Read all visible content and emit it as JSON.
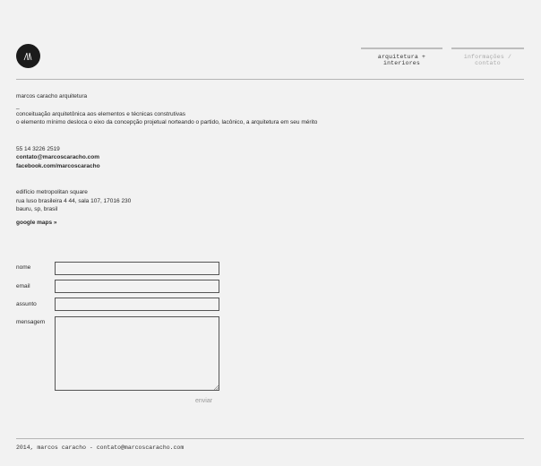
{
  "header": {
    "logo_icon": "monogram-logo-icon",
    "nav": {
      "arquitetura": "arquitetura + interiores",
      "informacoes": "informações / contato"
    }
  },
  "about": {
    "name": "marcos caracho arquitetura",
    "dash": "_",
    "line1": "conceituação arquitetônica aos elementos e técnicas construtivas",
    "line2": "o elemento mínimo desloca o eixo da concepção projetual norteando o partido, lacônico, a arquitetura em seu mérito"
  },
  "contact": {
    "phone": "55 14 3226 2519",
    "email": "contato@marcoscaracho.com",
    "facebook": "facebook.com/marcoscaracho"
  },
  "address": {
    "building": "edifício metropolitan square",
    "street": "rua luso brasileira 4 44, sala 107, 17016 230",
    "city": "bauru, sp, brasil",
    "maps_link": "google maps »"
  },
  "form": {
    "nome_label": "nome",
    "email_label": "email",
    "assunto_label": "assunto",
    "mensagem_label": "mensagem",
    "nome_value": "",
    "email_value": "",
    "assunto_value": "",
    "mensagem_value": "",
    "submit_label": "enviar"
  },
  "footer": {
    "text": "2014, marcos caracho - contato@marcoscaracho.com"
  }
}
